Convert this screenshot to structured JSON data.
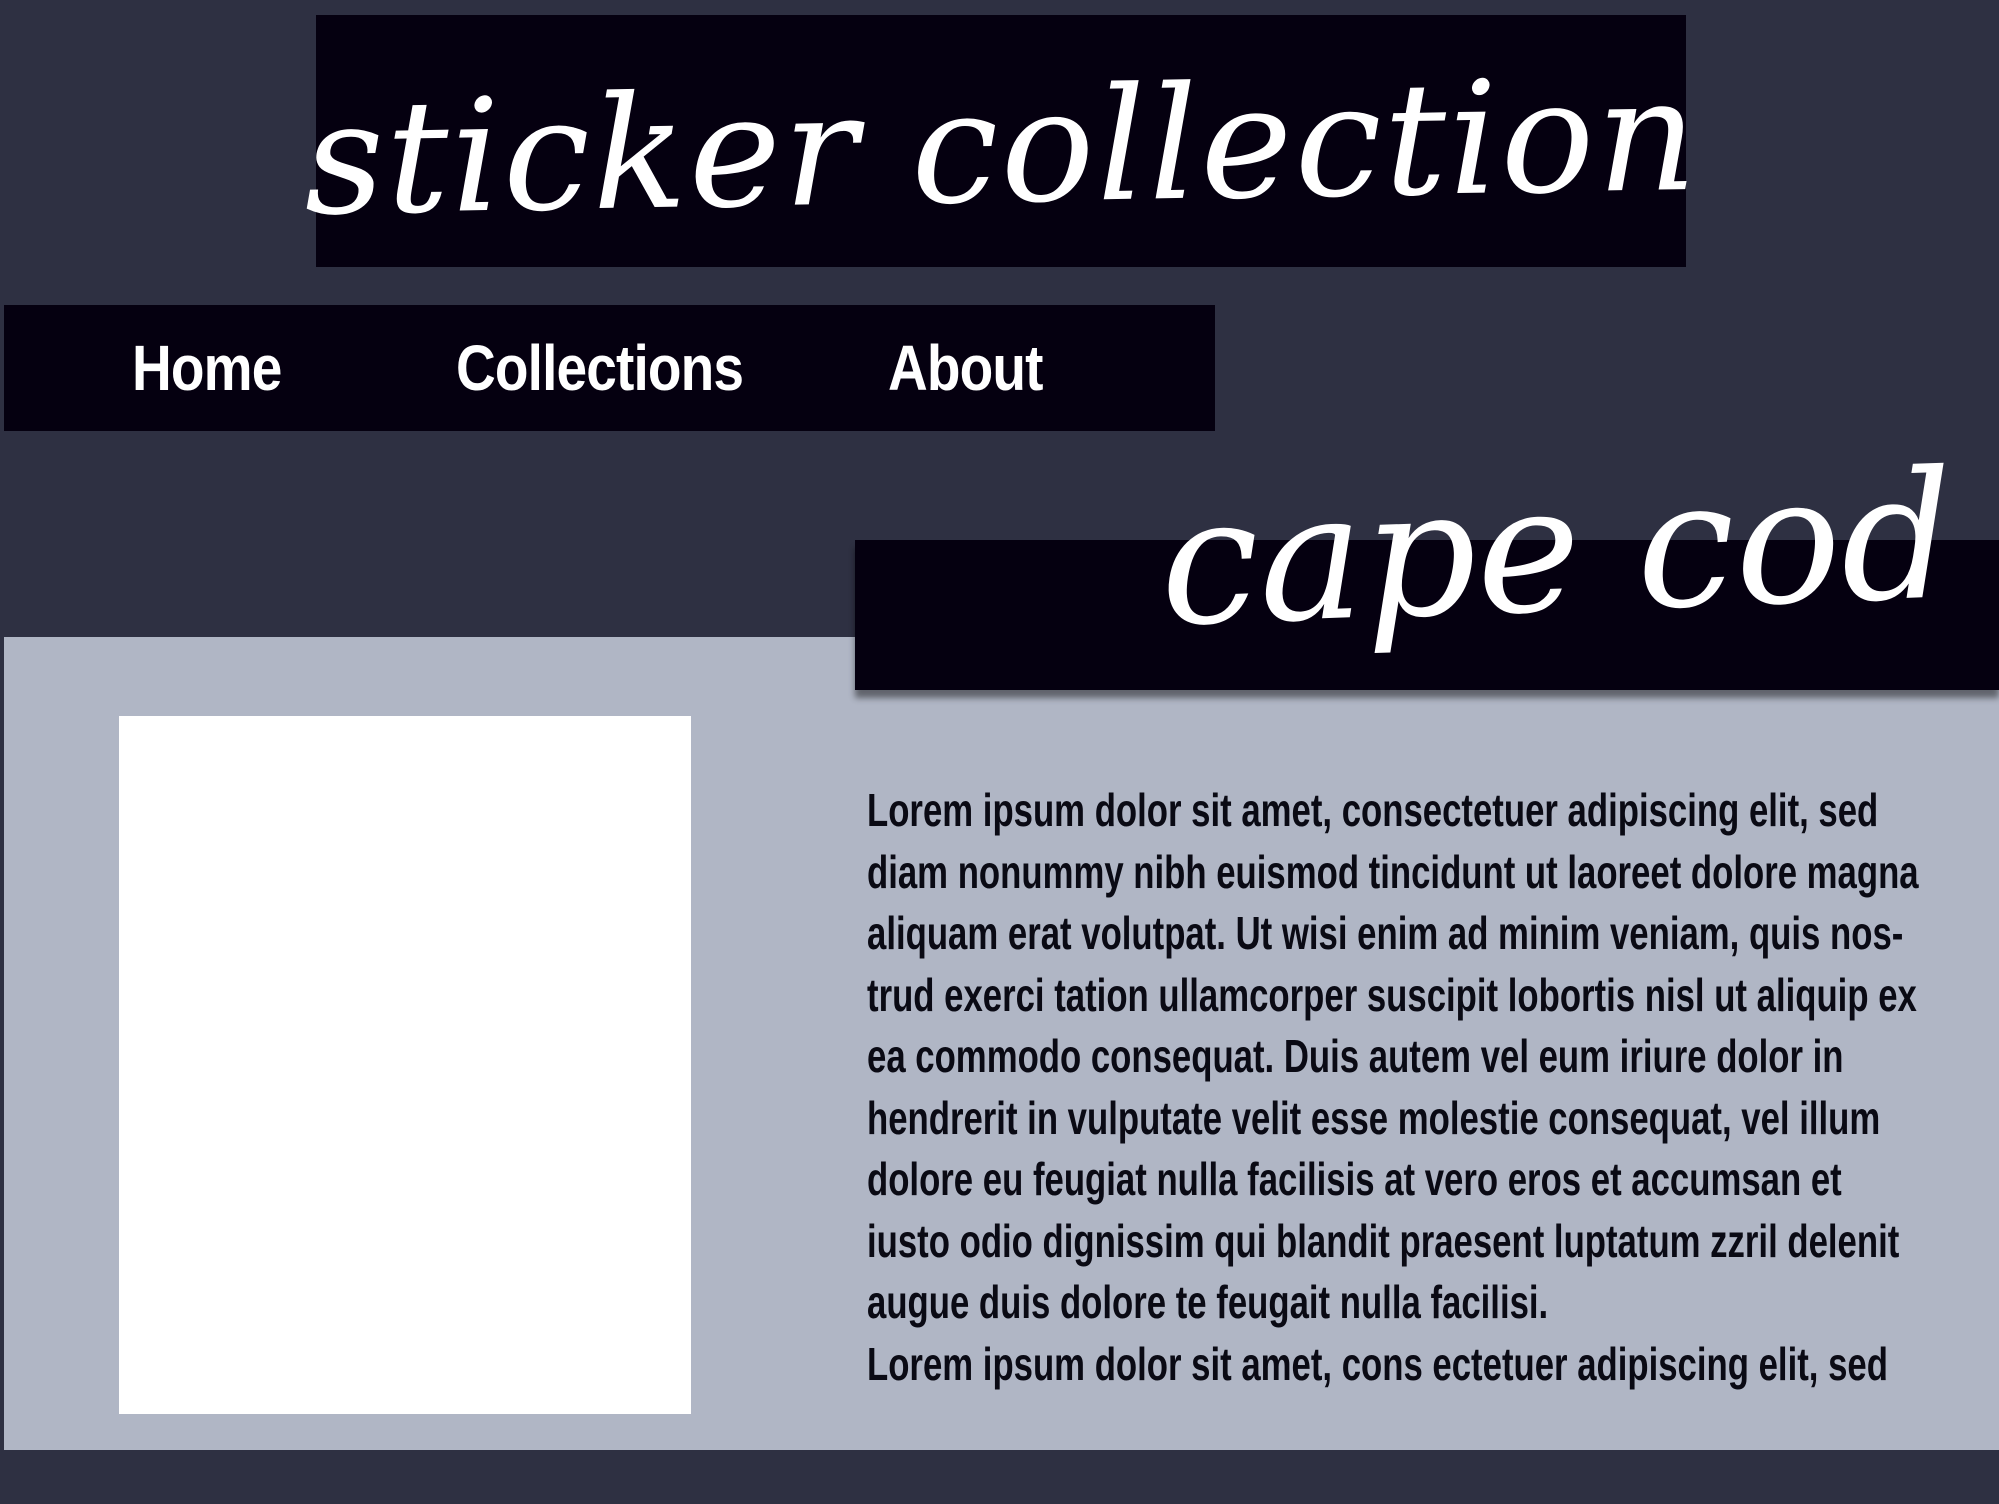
{
  "header": {
    "title": "sticker collection"
  },
  "nav": {
    "items": [
      {
        "label": "Home"
      },
      {
        "label": "Collections"
      },
      {
        "label": "About"
      }
    ]
  },
  "section": {
    "title": "cape cod",
    "body_lines": [
      "Lorem ipsum dolor sit amet, consectetuer adipiscing elit, sed",
      "diam nonummy nibh euismod tincidunt ut laoreet dolore magna",
      "aliquam erat volutpat. Ut wisi enim ad minim veniam, quis nos-",
      "trud exerci tation ullamcorper suscipit lobortis nisl ut aliquip ex",
      "ea commodo consequat. Duis autem vel eum iriure dolor in",
      "hendrerit in vulputate velit esse molestie consequat, vel illum",
      "dolore eu feugiat nulla facilisis at vero eros et accumsan et",
      "iusto odio dignissim qui blandit praesent luptatum zzril delenit",
      "augue duis dolore te feugait nulla facilisi.",
      "Lorem ipsum dolor sit amet, cons ectetuer adipiscing elit, sed"
    ]
  },
  "colors": {
    "background": "#2e3042",
    "banner": "#050010",
    "content_panel": "#b0b6c5",
    "image_placeholder": "#ffffff",
    "text_light": "#ffffff",
    "text_dark": "#0a0a14"
  }
}
